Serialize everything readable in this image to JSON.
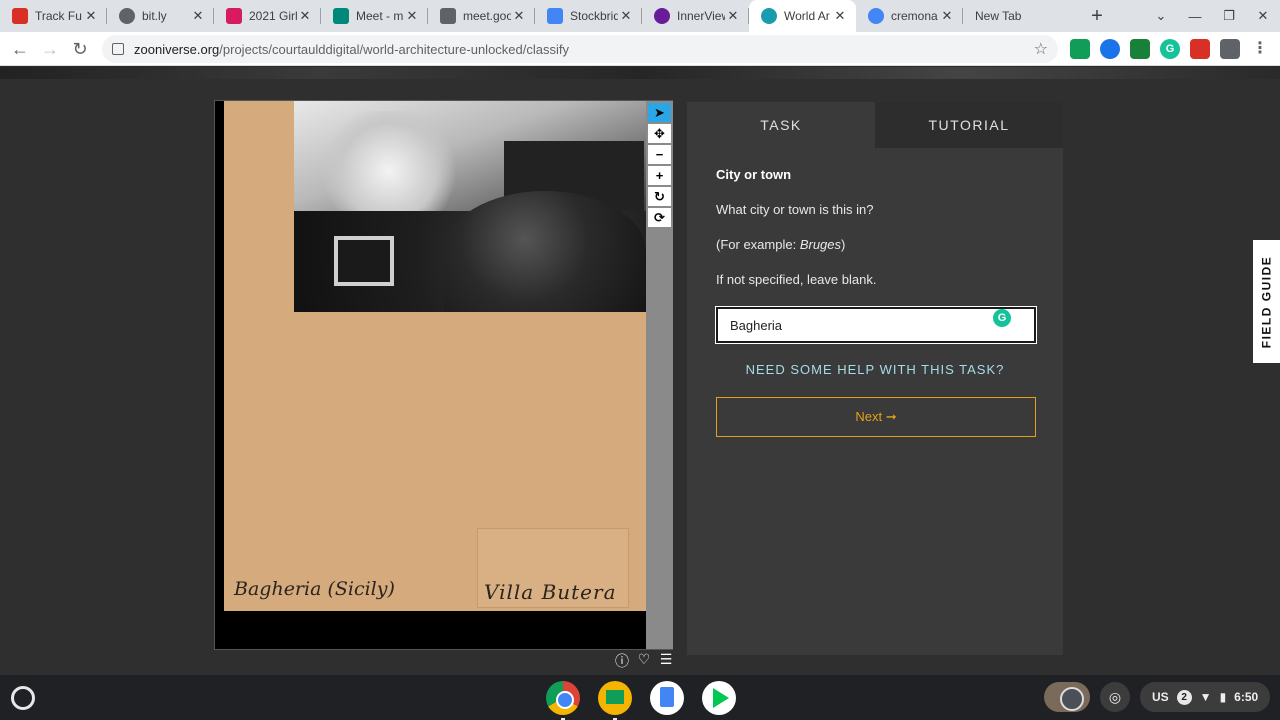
{
  "browser": {
    "tabs": [
      {
        "title": "Track Fu",
        "favicon_color": "#d93025",
        "active": false
      },
      {
        "title": "bit.ly",
        "favicon_color": "#5f6368",
        "active": false
      },
      {
        "title": "2021 Girl",
        "favicon_color": "#d81b60",
        "active": false
      },
      {
        "title": "Meet - m",
        "favicon_color": "#00897b",
        "active": false
      },
      {
        "title": "meet.goo",
        "favicon_color": "#5f6368",
        "active": false
      },
      {
        "title": "Stockbrid",
        "favicon_color": "#4285f4",
        "active": false
      },
      {
        "title": "InnerView",
        "favicon_color": "#6a1b9a",
        "active": false
      },
      {
        "title": "World Ar",
        "favicon_color": "#1a9cb0",
        "active": true
      },
      {
        "title": "cremona",
        "favicon_color": "#4285f4",
        "active": false
      },
      {
        "title": "New Tab",
        "favicon_color": "",
        "active": false
      }
    ],
    "url_host": "zooniverse.org",
    "url_path": "/projects/courtaulddigital/world-architecture-unlocked/classify"
  },
  "viewer": {
    "caption_left": "Bagheria (Sicily)",
    "caption_right": "Villa Butera",
    "tools": [
      "pointer-icon",
      "move-icon",
      "zoom-out-icon",
      "zoom-in-icon",
      "rotate-icon",
      "reset-icon"
    ]
  },
  "task_panel": {
    "tab_task": "TASK",
    "tab_tutorial": "TUTORIAL",
    "title": "City or town",
    "question": "What city or town is this in?",
    "example_prefix": "(For example: ",
    "example_value": "Bruges",
    "example_suffix": ")",
    "hint": "If not specified, leave blank.",
    "answer_value": "Bagheria",
    "help_link": "NEED SOME HELP WITH THIS TASK?",
    "next_label": "Next ➞"
  },
  "field_guide": {
    "label": "FIELD GUIDE"
  },
  "shelf": {
    "ime": "US",
    "notification_count": "2",
    "time": "6:50"
  },
  "colors": {
    "accent_next": "#e3a11b",
    "help_link": "#a6dce6",
    "active_tool": "#2aa5e6",
    "panel_bg": "#3a3a3a"
  }
}
